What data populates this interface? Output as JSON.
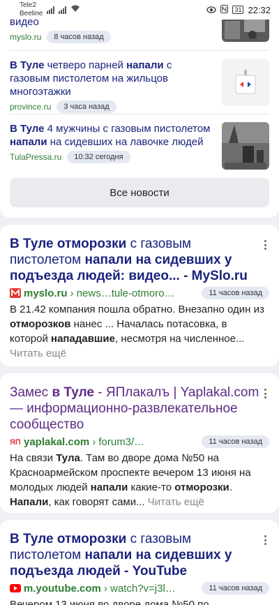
{
  "status_bar": {
    "carrier1": "Tele2",
    "carrier2": "Beeline",
    "battery": "31",
    "time": "22:32"
  },
  "news": {
    "items": [
      {
        "title_tail": "видео",
        "source": "myslo.ru",
        "time": "8 часов назад"
      },
      {
        "title_parts": [
          "В Туле",
          " четверо парней ",
          "напали",
          " с газовым пистолетом на жильцов многоэтажки"
        ],
        "source": "province.ru",
        "time": "3 часа назад"
      },
      {
        "title_parts": [
          "В Туле",
          " 4 мужчины с газовым пистолетом ",
          "напали",
          " на сидевших на лавочке людей"
        ],
        "source": "TulaPressa.ru",
        "time": "10:32 сегодня"
      }
    ],
    "all_news_label": "Все новости"
  },
  "results": [
    {
      "title_parts": [
        "В Туле отморозки",
        " с газовым пистолетом ",
        "напали на сидевших у подъезда людей: видео... - MySlo.ru"
      ],
      "domain": "myslo.ru",
      "path": "› news…tule-otmoro…",
      "time": "11 часов назад",
      "snippet_parts": [
        "В 21.42 компания пошла обратно. Внезапно один из ",
        "отморозков",
        " нанес ... Началась потасовка, в которой ",
        "нападавшие",
        ", несмотря на численное..."
      ],
      "more": "Читать ещё"
    },
    {
      "title_parts": [
        "Замес ",
        "в Туле",
        " - ЯПлакалъ | Yaplakal.com — информационно-развлекательное сообщество"
      ],
      "domain": "yaplakal.com",
      "path": "› forum3/…",
      "time": "11 часов назад",
      "snippet_parts": [
        "На связи ",
        "Тула",
        ". Там во дворе дома №50 на Красноармейском проспекте вечером 13 июня на молодых людей ",
        "напали",
        " какие-то ",
        "отморозки",
        ". ",
        "Напали",
        ", как говорят сами..."
      ],
      "more": "Читать ещё"
    },
    {
      "title_parts": [
        "В Туле отморозки",
        " с газовым пистолетом ",
        "напали на сидевших у подъезда людей - YouTube"
      ],
      "domain": "m.youtube.com",
      "path": "› watch?v=j3l…",
      "time": "11 часов назад",
      "snippet_start": "Вечером 13 июня во дворе дома №50 по"
    }
  ],
  "colors": {
    "title_link": "#1a237e",
    "visited_link": "#5e2a84",
    "source_green": "#2e7d32",
    "myslo_red": "#e53935",
    "youtube_red": "#ff0000"
  }
}
